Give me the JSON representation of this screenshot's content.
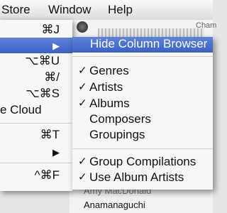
{
  "menubar": {
    "items": [
      "Store",
      "Window",
      "Help"
    ]
  },
  "background_window": {
    "cham_text": "Cham",
    "rows": [
      "Amy MacDonald",
      "Anamanaguchi"
    ]
  },
  "menu": {
    "items": [
      {
        "label": "",
        "shortcut": "⌘J"
      },
      {
        "label": "",
        "submenu_arrow": "▶",
        "highlighted": true
      },
      {
        "label": "",
        "shortcut": "⌥⌘U"
      },
      {
        "label": "",
        "shortcut": "⌘/"
      },
      {
        "label": "",
        "shortcut": "⌥⌘S"
      },
      {
        "label": "e Cloud",
        "shortcut": ""
      },
      {
        "label": "",
        "shortcut": "⌘T"
      },
      {
        "label": "",
        "submenu_arrow": "▶"
      },
      {
        "label": "",
        "shortcut": "^⌘F"
      }
    ]
  },
  "submenu": {
    "items": [
      {
        "label": "Hide Column Browser",
        "checked": false,
        "highlighted": true
      },
      {
        "label": "Genres",
        "checked": true
      },
      {
        "label": "Artists",
        "checked": true
      },
      {
        "label": "Albums",
        "checked": true
      },
      {
        "label": "Composers",
        "checked": false
      },
      {
        "label": "Groupings",
        "checked": false
      },
      {
        "label": "Group Compilations",
        "checked": true
      },
      {
        "label": "Use Album Artists",
        "checked": true
      }
    ],
    "check_glyph": "✓"
  },
  "colors": {
    "highlight": "#3f68cc",
    "menu_bg": "#f7f7f7"
  }
}
